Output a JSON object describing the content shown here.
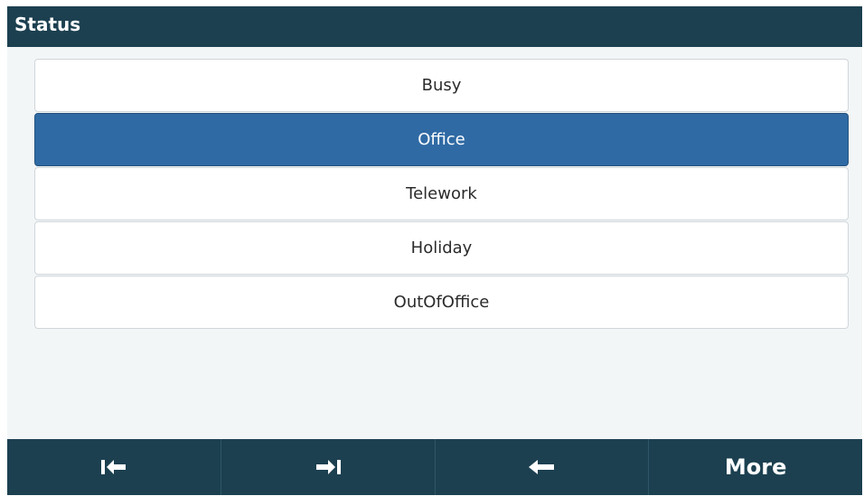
{
  "header": {
    "title": "Status"
  },
  "status_list": {
    "items": [
      {
        "label": "Busy",
        "selected": false
      },
      {
        "label": "Office",
        "selected": true
      },
      {
        "label": "Telework",
        "selected": false
      },
      {
        "label": "Holiday",
        "selected": false
      },
      {
        "label": "OutOfOffice",
        "selected": false
      }
    ]
  },
  "softkeys": {
    "first": {
      "icon": "arrow-to-start-icon"
    },
    "second": {
      "icon": "arrow-to-end-icon"
    },
    "third": {
      "icon": "back-arrow-icon"
    },
    "more_label": "More"
  },
  "colors": {
    "title_bar": "#1c4050",
    "softkey_bar": "#1c4050",
    "selected_item": "#2f6aa4",
    "background": "#f3f6f7"
  }
}
